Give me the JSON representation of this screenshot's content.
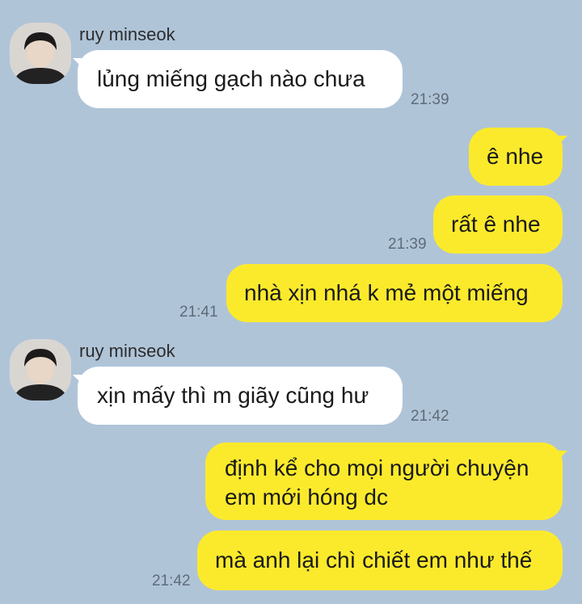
{
  "messages": [
    {
      "sender": "ruy minseok",
      "text": "lủng miếng gạch nào chưa",
      "time": "21:39"
    },
    {
      "text": "ê nhe"
    },
    {
      "text": "rất ê nhe",
      "time": "21:39"
    },
    {
      "text": "nhà xịn nhá k mẻ một miếng",
      "time": "21:41"
    },
    {
      "sender": "ruy minseok",
      "text": "xịn mấy thì m giãy cũng hư",
      "time": "21:42"
    },
    {
      "text": "định kể cho mọi người chuyện em mới hóng dc"
    },
    {
      "text": "mà anh lại chì chiết em như thế",
      "time": "21:42"
    }
  ],
  "colors": {
    "background": "#b0c4d8",
    "incoming_bubble": "#ffffff",
    "outgoing_bubble": "#fbea2c"
  }
}
